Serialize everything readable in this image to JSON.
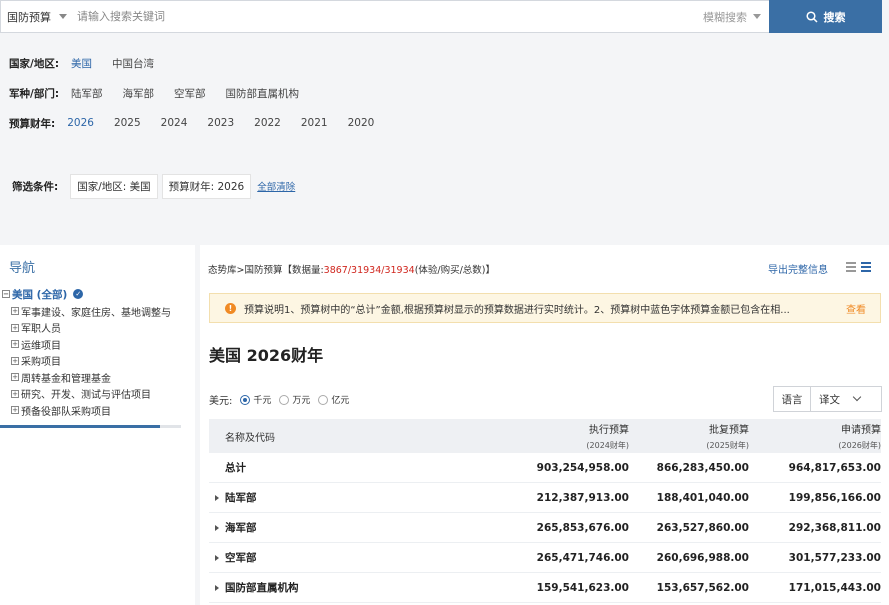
{
  "search": {
    "scope": "国防预算",
    "placeholder": "请输入搜索关键词",
    "mode": "模糊搜索",
    "button": "搜索"
  },
  "filters": [
    {
      "label": "国家/地区:",
      "options": [
        "美国",
        "中国台湾"
      ],
      "active": 0
    },
    {
      "label": "军种/部门:",
      "options": [
        "陆军部",
        "海军部",
        "空军部",
        "国防部直属机构"
      ],
      "active": -1
    },
    {
      "label": "预算财年:",
      "options": [
        "2026",
        "2025",
        "2024",
        "2023",
        "2022",
        "2021",
        "2020"
      ],
      "active": 0
    }
  ],
  "selected": {
    "label": "筛选条件:",
    "tags": [
      "国家/地区: 美国",
      "预算财年: 2026"
    ],
    "clear": "全部清除"
  },
  "sidebar": {
    "title": "导航",
    "root": "美国 (全部)",
    "items": [
      "军事建设、家庭住房、基地调整与",
      "军职人员",
      "运维项目",
      "采购项目",
      "周转基金和管理基金",
      "研究、开发、测试与评估项目",
      "预备役部队采购项目"
    ]
  },
  "main": {
    "crumbs_prefix": "态势库>国防预算【数据量:",
    "crumbs_count": "3867/31934/31934",
    "crumbs_suffix": "(体验/购买/总数)】",
    "export": "导出完整信息",
    "notice": "预算说明1、预算树中的“总计”金额,根据预算树显示的预算数据进行实时统计。2、预算树中蓝色字体预算金额已包含在相...",
    "notice_link": "查看",
    "heading": "美国 2026财年",
    "unit_label": "美元:",
    "units": [
      "千元",
      "万元",
      "亿元"
    ],
    "unit_selected": 0,
    "lang_label": "语言",
    "lang_value": "译文"
  },
  "table": {
    "headers": {
      "name": "名称及代码",
      "c1": "执行预算",
      "c1_sub": "(2024财年)",
      "c2": "批复预算",
      "c2_sub": "(2025财年)",
      "c3": "申请预算",
      "c3_sub": "(2026财年)"
    },
    "rows": [
      {
        "name": "总计",
        "expand": false,
        "c1": "903,254,958.00",
        "c2": "866,283,450.00",
        "c3": "964,817,653.00"
      },
      {
        "name": "陆军部",
        "expand": true,
        "c1": "212,387,913.00",
        "c2": "188,401,040.00",
        "c3": "199,856,166.00"
      },
      {
        "name": "海军部",
        "expand": true,
        "c1": "265,853,676.00",
        "c2": "263,527,860.00",
        "c3": "292,368,811.00"
      },
      {
        "name": "空军部",
        "expand": true,
        "c1": "265,471,746.00",
        "c2": "260,696,988.00",
        "c3": "301,577,233.00"
      },
      {
        "name": "国防部直属机构",
        "expand": true,
        "c1": "159,541,623.00",
        "c2": "153,657,562.00",
        "c3": "171,015,443.00"
      }
    ]
  },
  "colors": {
    "accent": "#3a6fa5",
    "link": "#2d66a8",
    "warn": "#f08a24",
    "count": "#d0261e"
  }
}
